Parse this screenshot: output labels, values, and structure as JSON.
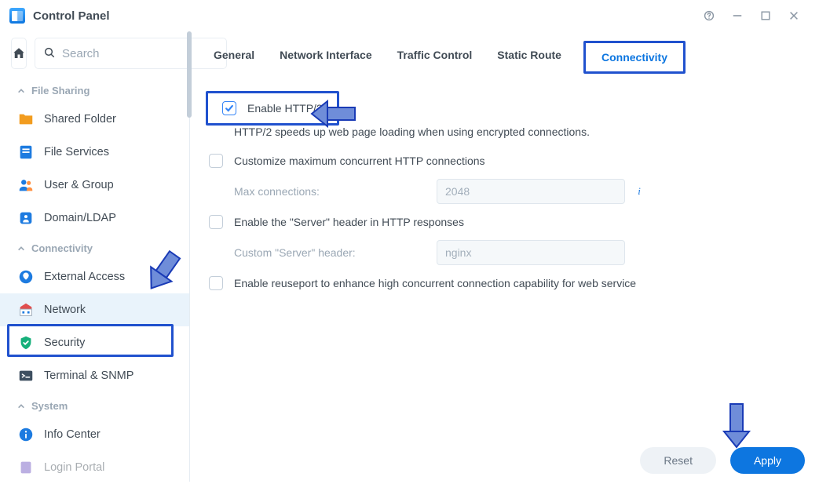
{
  "window": {
    "title": "Control Panel"
  },
  "search": {
    "placeholder": "Search"
  },
  "sidebar": {
    "sections": [
      {
        "label": "File Sharing",
        "items": [
          {
            "label": "Shared Folder"
          },
          {
            "label": "File Services"
          },
          {
            "label": "User & Group"
          },
          {
            "label": "Domain/LDAP"
          }
        ]
      },
      {
        "label": "Connectivity",
        "items": [
          {
            "label": "External Access"
          },
          {
            "label": "Network"
          },
          {
            "label": "Security"
          },
          {
            "label": "Terminal & SNMP"
          }
        ]
      },
      {
        "label": "System",
        "items": [
          {
            "label": "Info Center"
          },
          {
            "label": "Login Portal"
          }
        ]
      }
    ]
  },
  "tabs": [
    {
      "label": "General"
    },
    {
      "label": "Network Interface"
    },
    {
      "label": "Traffic Control"
    },
    {
      "label": "Static Route"
    },
    {
      "label": "Connectivity"
    }
  ],
  "form": {
    "enable_http2": "Enable HTTP/2",
    "http2_desc": "HTTP/2 speeds up web page loading when using encrypted connections.",
    "customize_max": "Customize maximum concurrent HTTP connections",
    "max_conn_label": "Max connections:",
    "max_conn_value": "2048",
    "enable_server_header": "Enable the \"Server\" header in HTTP responses",
    "custom_header_label": "Custom \"Server\" header:",
    "custom_header_value": "nginx",
    "enable_reuseport": "Enable reuseport to enhance high concurrent connection capability for web service"
  },
  "footer": {
    "reset": "Reset",
    "apply": "Apply"
  }
}
